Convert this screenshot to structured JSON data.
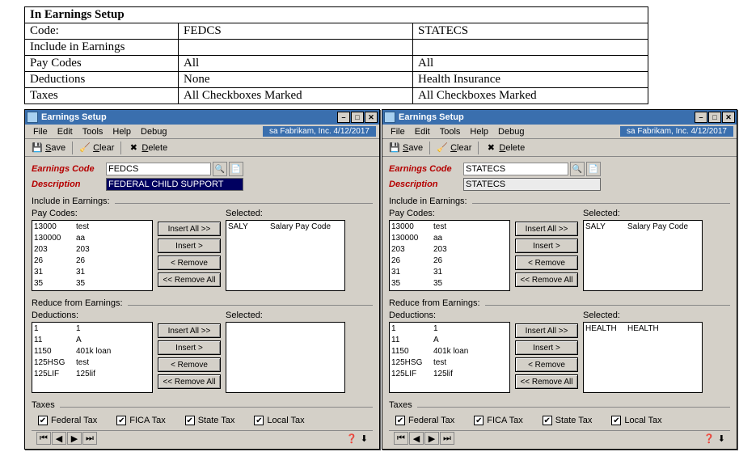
{
  "summary": {
    "header": "In Earnings Setup",
    "rows": [
      {
        "label": "Code:",
        "col1": "FEDCS",
        "col2": "STATECS"
      },
      {
        "label": "Include in Earnings",
        "col1": "",
        "col2": ""
      },
      {
        "label": "Pay Codes",
        "col1": "All",
        "col2": "All"
      },
      {
        "label": "Deductions",
        "col1": "None",
        "col2": "Health Insurance"
      },
      {
        "label": "Taxes",
        "col1": "All Checkboxes Marked",
        "col2": "All Checkboxes Marked"
      }
    ]
  },
  "windows": [
    {
      "title": "Earnings Setup",
      "status": "sa  Fabrikam, Inc.  4/12/2017",
      "earnings_code": "FEDCS",
      "description": "FEDERAL CHILD SUPPORT",
      "paycodes": [
        {
          "code": "13000",
          "desc": "test"
        },
        {
          "code": "130000",
          "desc": "aa"
        },
        {
          "code": "203",
          "desc": "203"
        },
        {
          "code": "26",
          "desc": "26"
        },
        {
          "code": "31",
          "desc": "31"
        },
        {
          "code": "35",
          "desc": "35"
        }
      ],
      "paycodes_selected": [
        {
          "code": "SALY",
          "desc": "Salary Pay Code"
        }
      ],
      "deductions": [
        {
          "code": "1",
          "desc": "1"
        },
        {
          "code": "11",
          "desc": "A"
        },
        {
          "code": "1150",
          "desc": "401k loan"
        },
        {
          "code": "125HSG",
          "desc": "test"
        },
        {
          "code": "125LIF",
          "desc": "125lif"
        }
      ],
      "deductions_selected": [],
      "taxes": {
        "federal": true,
        "fica": true,
        "state": true,
        "local": true
      }
    },
    {
      "title": "Earnings Setup",
      "status": "sa  Fabrikam, Inc.  4/12/2017",
      "earnings_code": "STATECS",
      "description": "STATECS",
      "paycodes": [
        {
          "code": "13000",
          "desc": "test"
        },
        {
          "code": "130000",
          "desc": "aa"
        },
        {
          "code": "203",
          "desc": "203"
        },
        {
          "code": "26",
          "desc": "26"
        },
        {
          "code": "31",
          "desc": "31"
        },
        {
          "code": "35",
          "desc": "35"
        }
      ],
      "paycodes_selected": [
        {
          "code": "SALY",
          "desc": "Salary Pay Code"
        }
      ],
      "deductions": [
        {
          "code": "1",
          "desc": "1"
        },
        {
          "code": "11",
          "desc": "A"
        },
        {
          "code": "1150",
          "desc": "401k loan"
        },
        {
          "code": "125HSG",
          "desc": "test"
        },
        {
          "code": "125LIF",
          "desc": "125lif"
        }
      ],
      "deductions_selected": [
        {
          "code": "HEALTH",
          "desc": "HEALTH"
        }
      ],
      "taxes": {
        "federal": true,
        "fica": true,
        "state": true,
        "local": true
      }
    }
  ],
  "labels": {
    "menu": {
      "file": "File",
      "edit": "Edit",
      "tools": "Tools",
      "help": "Help",
      "debug": "Debug"
    },
    "toolbar": {
      "save": "Save",
      "clear": "Clear",
      "delete": "Delete"
    },
    "fields": {
      "earnings_code": "Earnings Code",
      "description": "Description"
    },
    "groups": {
      "include": "Include in Earnings:",
      "reduce": "Reduce from Earnings:",
      "taxes": "Taxes"
    },
    "lists": {
      "paycodes": "Pay Codes:",
      "deductions": "Deductions:",
      "selected": "Selected:"
    },
    "buttons": {
      "insert_all": "Insert All >>",
      "insert": "Insert >",
      "remove": "< Remove",
      "remove_all": "<< Remove All"
    },
    "taxes": {
      "federal": "Federal Tax",
      "fica": "FICA Tax",
      "state": "State Tax",
      "local": "Local Tax"
    }
  }
}
